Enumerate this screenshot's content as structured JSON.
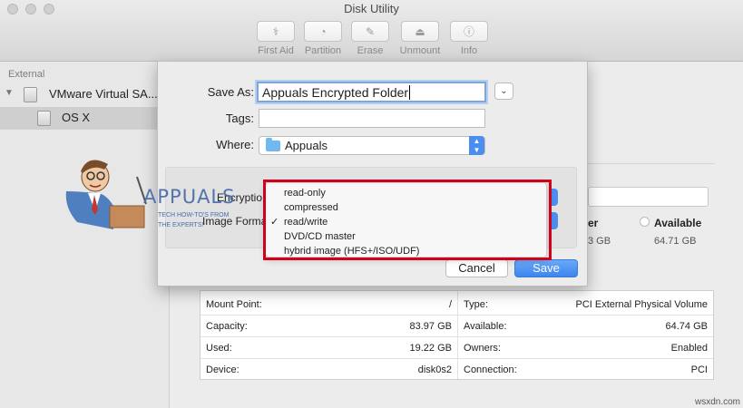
{
  "window": {
    "title": "Disk Utility"
  },
  "toolbar": [
    {
      "label": "First Aid",
      "icon": "stethoscope-icon"
    },
    {
      "label": "Partition",
      "icon": "pie-icon"
    },
    {
      "label": "Erase",
      "icon": "eraser-icon"
    },
    {
      "label": "Unmount",
      "icon": "eject-icon"
    },
    {
      "label": "Info",
      "icon": "info-icon"
    }
  ],
  "sidebar": {
    "section": "External",
    "items": [
      {
        "label": "VMware Virtual SA..."
      },
      {
        "label": "OS X"
      }
    ]
  },
  "sheet": {
    "save_as_label": "Save As:",
    "save_as_value": "Appuals Encrypted Folder",
    "tags_label": "Tags:",
    "where_label": "Where:",
    "where_value": "Appuals",
    "encryption_label": "Encryptio",
    "image_format_label": "Image Forma",
    "cancel": "Cancel",
    "save": "Save"
  },
  "format_menu": {
    "items": [
      "read-only",
      "compressed",
      "read/write",
      "DVD/CD master",
      "hybrid image (HFS+/ISO/UDF)"
    ],
    "selected": "read/write",
    "check": "✓"
  },
  "behind": {
    "legend_partial": "er",
    "available_label": "Available",
    "used_partial": "3 GB",
    "available_value": "64.71 GB"
  },
  "info": {
    "left": [
      {
        "key": "Mount Point:",
        "value": "/"
      },
      {
        "key": "Capacity:",
        "value": "83.97 GB"
      },
      {
        "key": "Used:",
        "value": "19.22 GB"
      },
      {
        "key": "Device:",
        "value": "disk0s2"
      }
    ],
    "right": [
      {
        "key": "Type:",
        "value": "PCI External Physical Volume"
      },
      {
        "key": "Available:",
        "value": "64.74 GB"
      },
      {
        "key": "Owners:",
        "value": "Enabled"
      },
      {
        "key": "Connection:",
        "value": "PCI"
      }
    ]
  },
  "watermark": {
    "brand": "APPUALS",
    "tagline": [
      "TECH HOW-TO'S FROM",
      "THE EXPERTS!"
    ]
  },
  "credit": "wsxdn.com",
  "colors": {
    "accent": "#4a8ef0",
    "highlight_box": "#d0021b"
  }
}
